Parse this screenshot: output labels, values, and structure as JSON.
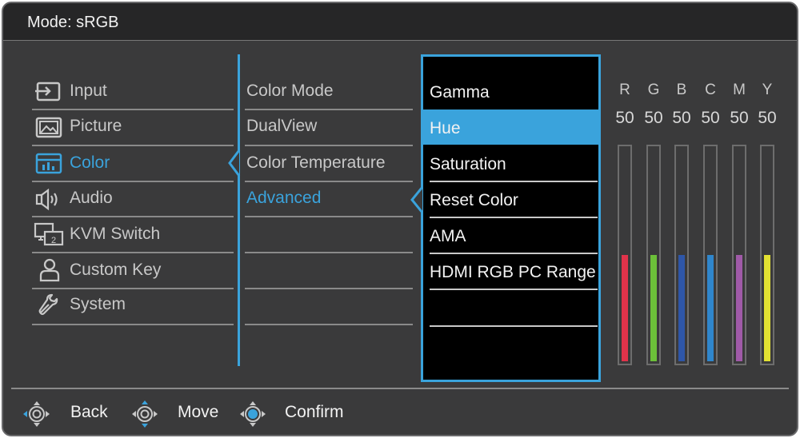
{
  "title": "Mode: sRGB",
  "main_menu": [
    {
      "label": "Input",
      "icon": "input-icon",
      "active": false
    },
    {
      "label": "Picture",
      "icon": "picture-icon",
      "active": false
    },
    {
      "label": "Color",
      "icon": "color-icon",
      "active": true
    },
    {
      "label": "Audio",
      "icon": "audio-icon",
      "active": false
    },
    {
      "label": "KVM Switch",
      "icon": "kvm-switch-icon",
      "active": false
    },
    {
      "label": "Custom Key",
      "icon": "custom-key-icon",
      "active": false
    },
    {
      "label": "System",
      "icon": "system-icon",
      "active": false
    }
  ],
  "color_menu": [
    {
      "label": "Color Mode",
      "active": false
    },
    {
      "label": "DualView",
      "active": false
    },
    {
      "label": "Color Temperature",
      "active": false
    },
    {
      "label": "Advanced",
      "active": true
    }
  ],
  "advanced_menu": [
    {
      "label": "Gamma"
    },
    {
      "label": "Hue"
    },
    {
      "label": "Saturation"
    },
    {
      "label": "Reset Color"
    },
    {
      "label": "AMA"
    },
    {
      "label": "HDMI RGB PC Range"
    }
  ],
  "advanced_selected_index": 1,
  "hue_channels": [
    {
      "name": "R",
      "value": "50",
      "level": 50,
      "color": "#e0334a"
    },
    {
      "name": "G",
      "value": "50",
      "level": 50,
      "color": "#6cc039"
    },
    {
      "name": "B",
      "value": "50",
      "level": 50,
      "color": "#2e56a8"
    },
    {
      "name": "C",
      "value": "50",
      "level": 50,
      "color": "#2f86cc"
    },
    {
      "name": "M",
      "value": "50",
      "level": 50,
      "color": "#a05aa8"
    },
    {
      "name": "Y",
      "value": "50",
      "level": 50,
      "color": "#e2e032"
    }
  ],
  "footer": {
    "back_label": "Back",
    "move_label": "Move",
    "confirm_label": "Confirm"
  },
  "colors": {
    "accent": "#3aa3dc",
    "background": "#3a3a3b",
    "titlebar": "#262627"
  }
}
